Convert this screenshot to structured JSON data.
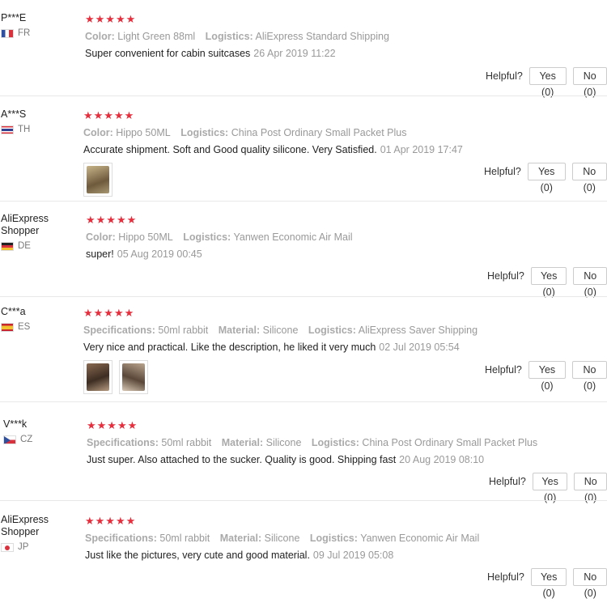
{
  "labels": {
    "helpful": "Helpful?"
  },
  "colors": {
    "star": "#e62e3d",
    "muted": "#999999",
    "text": "#222222"
  },
  "reviews": [
    {
      "user": "P***E",
      "country": "FR",
      "stars": "★★★★★",
      "attrs": [
        {
          "k": "Color:",
          "v": "Light Green 88ml"
        },
        {
          "k": "Logistics:",
          "v": "AliExpress Standard Shipping"
        }
      ],
      "text": "Super convenient for cabin suitcases",
      "date": "26 Apr 2019 11:22",
      "yes": "Yes (0)",
      "no": "No (0)"
    },
    {
      "user": "A***S",
      "country": "TH",
      "stars": "★★★★★",
      "attrs": [
        {
          "k": "Color:",
          "v": "Hippo 50ML"
        },
        {
          "k": "Logistics:",
          "v": "China Post Ordinary Small Packet Plus"
        }
      ],
      "text": "Accurate shipment. Soft and Good quality silicone. Very Satisfied.",
      "date": "01 Apr 2019 17:47",
      "yes": "Yes (0)",
      "no": "No (0)"
    },
    {
      "user": "AliExpress Shopper",
      "country": "DE",
      "stars": "★★★★★",
      "attrs": [
        {
          "k": "Color:",
          "v": "Hippo 50ML"
        },
        {
          "k": "Logistics:",
          "v": "Yanwen Economic Air Mail"
        }
      ],
      "text": "super!",
      "date": "05 Aug 2019 00:45",
      "yes": "Yes (0)",
      "no": "No (0)"
    },
    {
      "user": "C***a",
      "country": "ES",
      "stars": "★★★★★",
      "attrs": [
        {
          "k": "Specifications:",
          "v": "50ml rabbit"
        },
        {
          "k": "Material:",
          "v": "Silicone"
        },
        {
          "k": "Logistics:",
          "v": "AliExpress Saver Shipping"
        }
      ],
      "text": "Very nice and practical. Like the description, he liked it very much",
      "date": "02 Jul 2019 05:54",
      "yes": "Yes (0)",
      "no": "No (0)"
    },
    {
      "user": "V***k",
      "country": "CZ",
      "stars": "★★★★★",
      "attrs": [
        {
          "k": "Specifications:",
          "v": "50ml rabbit"
        },
        {
          "k": "Material:",
          "v": "Silicone"
        },
        {
          "k": "Logistics:",
          "v": "China Post Ordinary Small Packet Plus"
        }
      ],
      "text": "Just super. Also attached to the sucker. Quality is good. Shipping fast",
      "date": "20 Aug 2019 08:10",
      "yes": "Yes (0)",
      "no": "No (0)"
    },
    {
      "user": "AliExpress Shopper",
      "country": "JP",
      "stars": "★★★★★",
      "attrs": [
        {
          "k": "Specifications:",
          "v": "50ml rabbit"
        },
        {
          "k": "Material:",
          "v": "Silicone"
        },
        {
          "k": "Logistics:",
          "v": "Yanwen Economic Air Mail"
        }
      ],
      "text": "Just like the pictures, very cute and good material.",
      "date": "09 Jul 2019 05:08",
      "yes": "Yes (0)",
      "no": "No (0)"
    }
  ]
}
